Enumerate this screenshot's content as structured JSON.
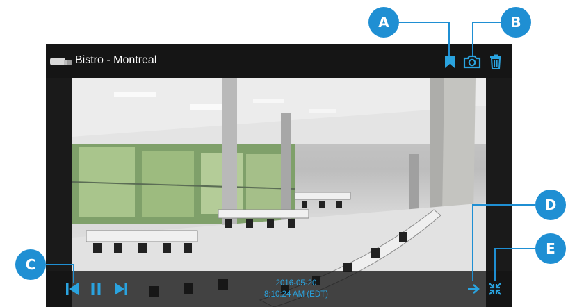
{
  "camera": {
    "title": "Bistro - Montreal"
  },
  "toolbar": {
    "icons": [
      "bookmark-icon",
      "camera-snapshot-icon",
      "trash-icon"
    ]
  },
  "playback": {
    "date": "2016-05-20",
    "time": "8:10:24 AM (EDT)",
    "controls": [
      "skip-previous-icon",
      "pause-icon",
      "skip-next-icon"
    ],
    "right_controls": [
      "arrow-right-icon",
      "collapse-fullscreen-icon"
    ]
  },
  "callouts": {
    "a": "A",
    "b": "B",
    "c": "C",
    "d": "D",
    "e": "E"
  },
  "colors": {
    "accent": "#2aa3df",
    "callout": "#1f8fd3",
    "bar": "#151515"
  }
}
